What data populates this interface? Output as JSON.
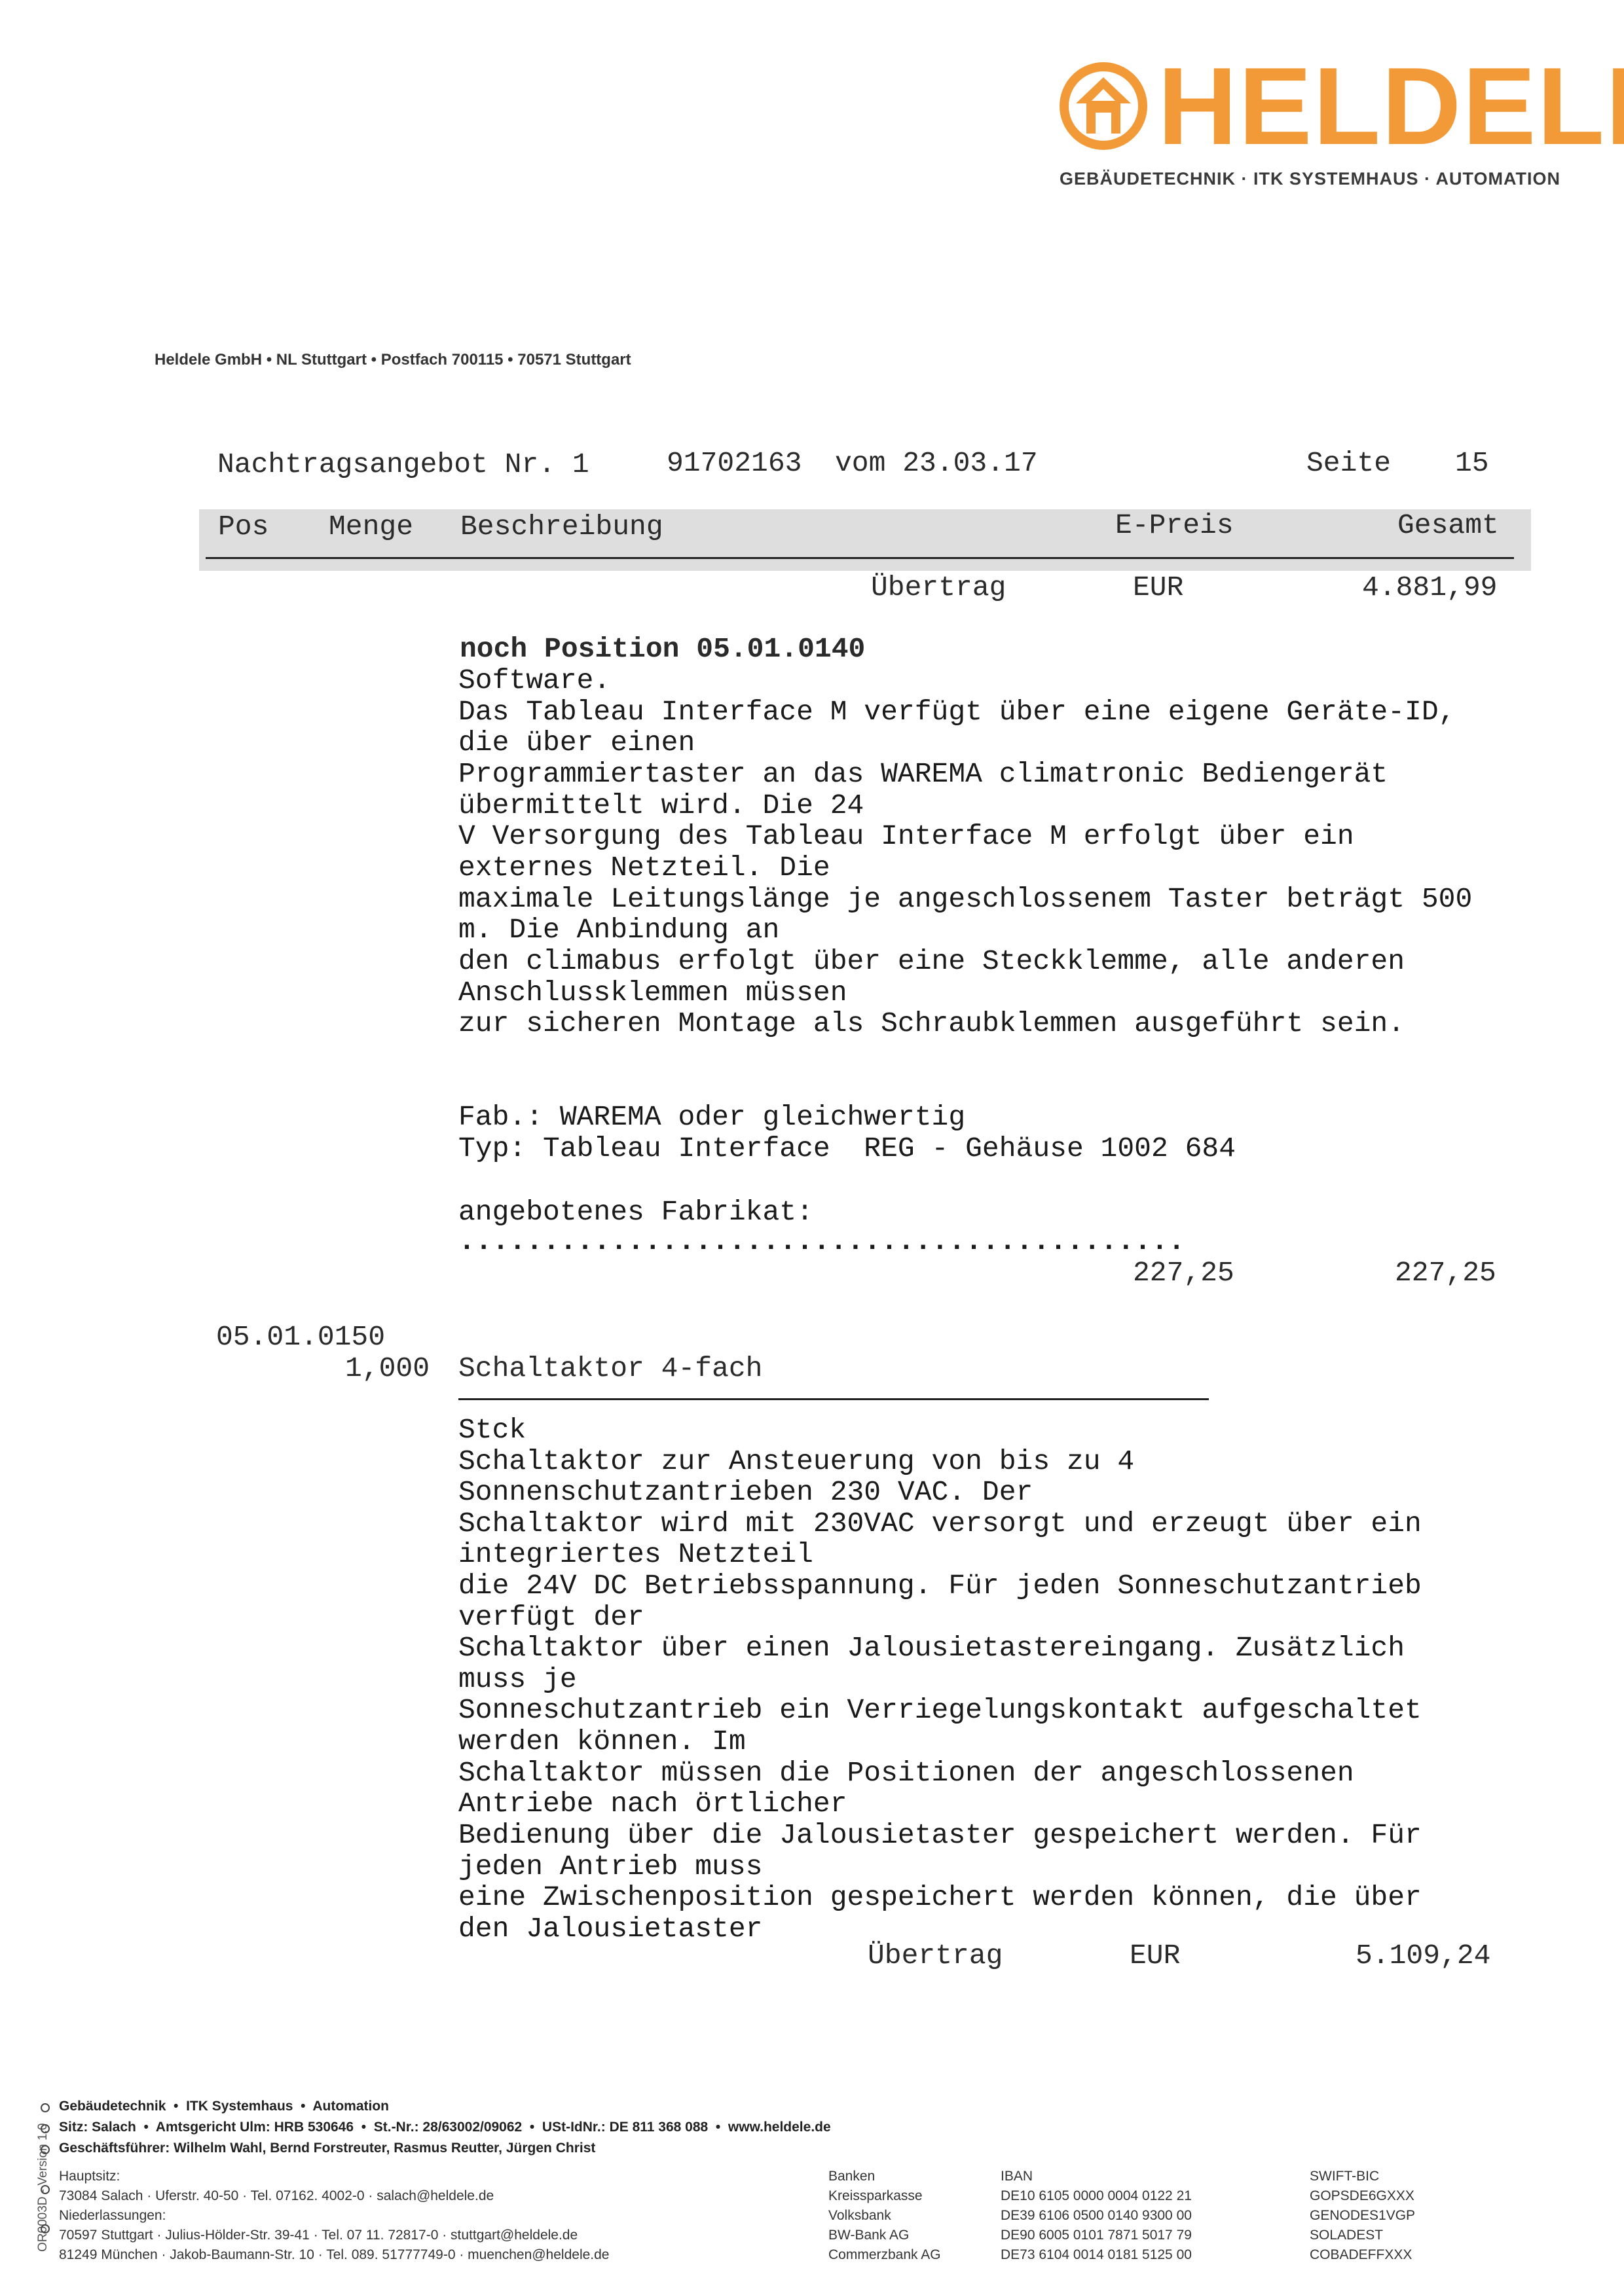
{
  "brand": {
    "name": "HELDELE",
    "tagline": "GEBÄUDETECHNIK · ITK SYSTEMHAUS · AUTOMATION",
    "accent_color": "#f29a38",
    "logo_icon": "heldele-house-arrow-logo"
  },
  "sender_line": "Heldele GmbH • NL Stuttgart • Postfach 700115 • 70571 Stuttgart",
  "document": {
    "title": "Nachtragsangebot Nr. 1",
    "number": "91702163",
    "date_label": "vom 23.03.17",
    "page_label": "Seite",
    "page_number": "15"
  },
  "table_header": {
    "pos": "Pos",
    "menge": "Menge",
    "beschreibung": "Beschreibung",
    "epreis": "E-Preis",
    "gesamt": "Gesamt"
  },
  "carry_in": {
    "label": "Übertrag",
    "currency": "EUR",
    "amount": "4.881,99"
  },
  "position_1": {
    "heading": "noch Position 05.01.0140",
    "lines": [
      "Software.",
      "Das Tableau Interface M verfügt über eine eigene Geräte-ID,",
      "die über einen",
      "Programmiertaster an das WAREMA climatronic Bediengerät",
      "übermittelt wird. Die 24",
      "V Versorgung des Tableau Interface M erfolgt über ein",
      "externes Netzteil. Die",
      "maximale Leitungslänge je angeschlossenem Taster beträgt 500",
      "m. Die Anbindung an",
      "den climabus erfolgt über eine Steckklemme, alle anderen",
      "Anschlussklemmen müssen",
      "zur sicheren Montage als Schraubklemmen ausgeführt sein."
    ],
    "fab": "Fab.: WAREMA oder gleichwertig",
    "typ": "Typ: Tableau Interface  REG - Gehäuse 1002 684",
    "offered_label": "angebotenes Fabrikat:",
    "dotted": "...........................................",
    "unit_price": "227,25",
    "total": "227,25"
  },
  "position_2": {
    "pos": "05.01.0150",
    "quantity": "1,000",
    "name": "Schaltaktor 4-fach",
    "unit": "Stck",
    "lines": [
      "Schaltaktor zur Ansteuerung von bis zu 4",
      "Sonnenschutzantrieben 230 VAC. Der",
      "Schaltaktor wird mit 230VAC versorgt und erzeugt über ein",
      "integriertes Netzteil",
      "die 24V DC Betriebsspannung. Für jeden Sonneschutzantrieb",
      "verfügt der",
      "Schaltaktor über einen Jalousietastereingang. Zusätzlich",
      "muss je",
      "Sonneschutzantrieb ein Verriegelungskontakt aufgeschaltet",
      "werden können. Im",
      "Schaltaktor müssen die Positionen der angeschlossenen",
      "Antriebe nach örtlicher",
      "Bedienung über die Jalousietaster gespeichert werden. Für",
      "jeden Antrieb muss",
      "eine Zwischenposition gespeichert werden können, die über",
      "den Jalousietaster"
    ]
  },
  "carry_out": {
    "label": "Übertrag",
    "currency": "EUR",
    "amount": "5.109,24"
  },
  "footer": {
    "side_id": "OR0003D - Version 1.0",
    "line1": "Gebäudetechnik  •  ITK Systemhaus  •  Automation",
    "line2": "Sitz: Salach  •  Amtsgericht Ulm: HRB 530646  •  St.-Nr.: 28/63002/09062  •  USt-IdNr.: DE 811 368 088  •  www.heldele.de",
    "line3": "Geschäftsführer: Wilhelm Wahl, Bernd Forstreuter, Rasmus Reutter, Jürgen Christ",
    "hq_label": "Hauptsitz:",
    "hq": "73084 Salach · Uferstr. 40-50 · Tel. 07162. 4002-0 · salach@heldele.de",
    "branches_label": "Niederlassungen:",
    "branch1": "70597 Stuttgart · Julius-Hölder-Str. 39-41 · Tel. 07 11. 72817-0 · stuttgart@heldele.de",
    "branch2": "81249 München · Jakob-Baumann-Str. 10 · Tel. 089. 51777749-0 · muenchen@heldele.de",
    "banks": {
      "header": [
        "Banken",
        "IBAN",
        "SWIFT-BIC"
      ],
      "rows": [
        [
          "Kreissparkasse",
          "DE10 6105 0000 0004 0122 21",
          "GOPSDE6GXXX"
        ],
        [
          "Volksbank",
          "DE39 6106 0500 0140 9300 00",
          "GENODES1VGP"
        ],
        [
          "BW-Bank AG",
          "DE90 6005 0101 7871 5017 79",
          "SOLADEST"
        ],
        [
          "Commerzbank AG",
          "DE73 6104 0014 0181 5125 00",
          "COBADEFFXXX"
        ]
      ]
    }
  }
}
